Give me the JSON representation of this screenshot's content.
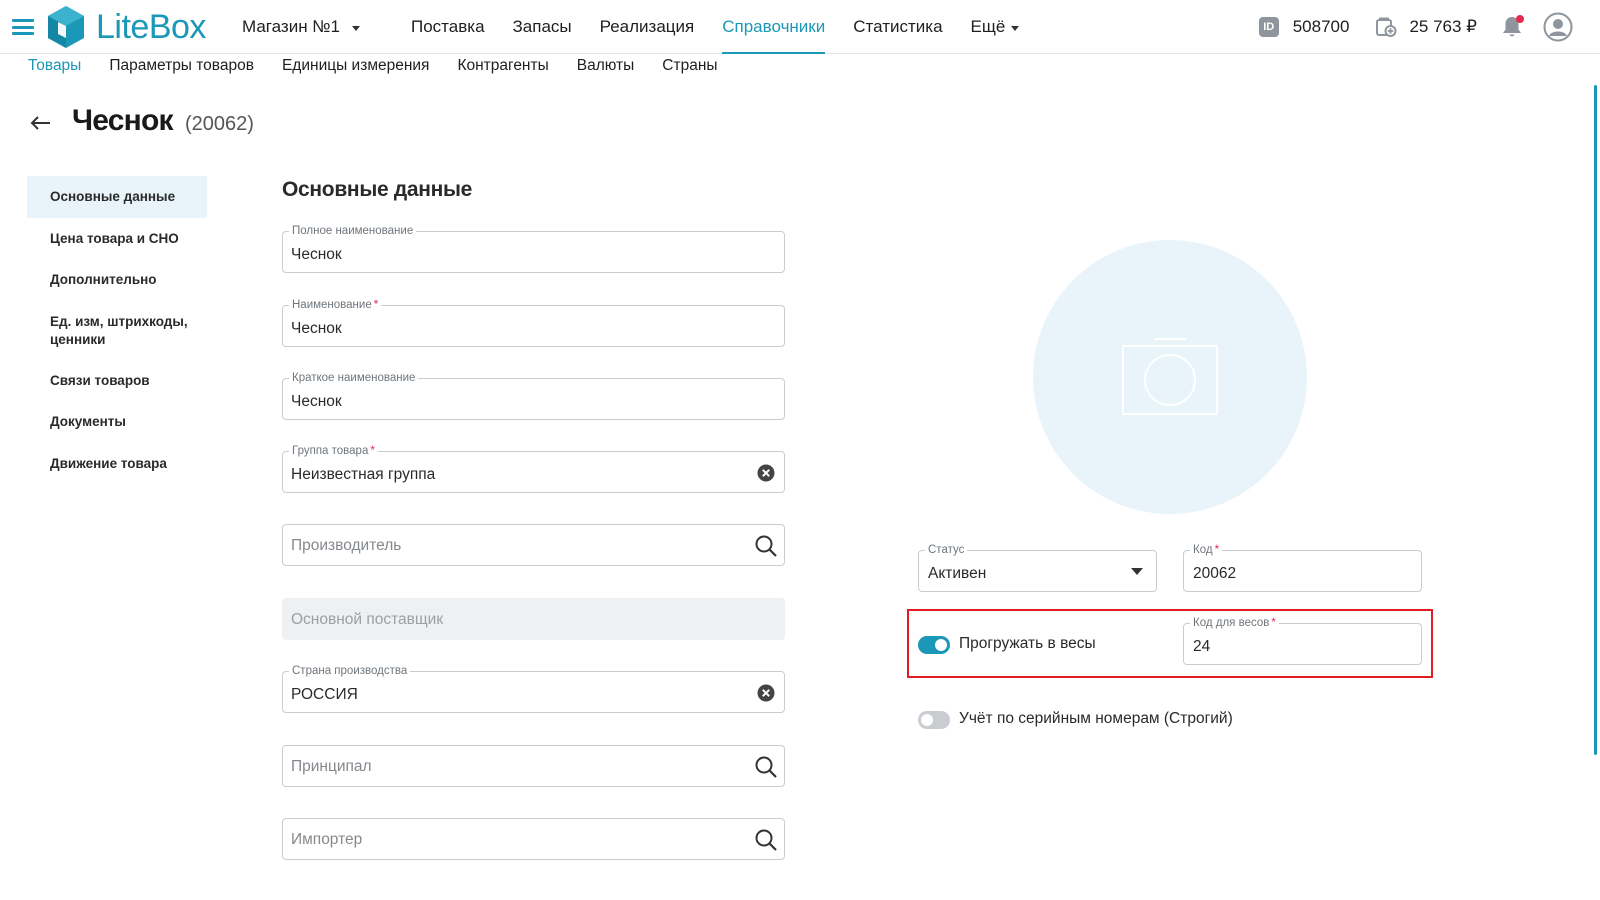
{
  "header": {
    "brand": "LiteBox",
    "store": "Магазин №1",
    "nav": [
      {
        "label": "Поставка"
      },
      {
        "label": "Запасы"
      },
      {
        "label": "Реализация"
      },
      {
        "label": "Справочники"
      },
      {
        "label": "Статистика"
      },
      {
        "label": "Ещё"
      }
    ],
    "active_nav": "Справочники",
    "id_badge": "ID",
    "account_id": "508700",
    "balance": "25 763 ₽",
    "notification_dot_color": "#e5294f"
  },
  "subnav": [
    {
      "label": "Товары"
    },
    {
      "label": "Параметры товаров"
    },
    {
      "label": "Единицы измерения"
    },
    {
      "label": "Контрагенты"
    },
    {
      "label": "Валюты"
    },
    {
      "label": "Страны"
    }
  ],
  "page": {
    "title": "Чеснок",
    "code": "(20062)"
  },
  "side_menu": [
    {
      "label": "Основные данные"
    },
    {
      "label": "Цена товара и СНО"
    },
    {
      "label": "Дополнительно"
    },
    {
      "label": "Ед. изм, штрихкоды, ценники"
    },
    {
      "label": "Связи товаров"
    },
    {
      "label": "Документы"
    },
    {
      "label": "Движение товара"
    }
  ],
  "form": {
    "heading": "Основные данные",
    "full_name": {
      "label": "Полное наименование",
      "value": "Чеснок"
    },
    "name": {
      "label": "Наименование",
      "required": "*",
      "value": "Чеснок"
    },
    "short_name": {
      "label": "Краткое наименование",
      "value": "Чеснок"
    },
    "group": {
      "label": "Группа товара",
      "required": "*",
      "value": "Неизвестная группа"
    },
    "manufacturer": {
      "placeholder": "Производитель"
    },
    "supplier": {
      "placeholder": "Основной поставщик"
    },
    "country": {
      "label": "Страна производства",
      "value": "РОССИЯ"
    },
    "principal": {
      "placeholder": "Принципал"
    },
    "importer": {
      "placeholder": "Импортер"
    }
  },
  "details": {
    "status": {
      "label": "Статус",
      "value": "Активен"
    },
    "code": {
      "label": "Код",
      "required": "*",
      "value": "20062"
    },
    "scales_toggle": {
      "label": "Прогружать в весы",
      "on": true
    },
    "scales_code": {
      "label": "Код для весов",
      "required": "*",
      "value": "24"
    },
    "serial_toggle": {
      "label": "Учёт по серийным номерам (Строгий)",
      "on": false
    }
  },
  "colors": {
    "accent": "#1b97b7",
    "highlight": "#e31b23",
    "photo_bg": "#e8f4fa",
    "required": "#e5294f"
  },
  "icons": [
    "menu-icon",
    "litebox-logo-icon",
    "back-arrow-icon",
    "clear-icon",
    "search-icon",
    "camera-icon",
    "bell-icon",
    "wallet-icon",
    "user-avatar-icon"
  ]
}
